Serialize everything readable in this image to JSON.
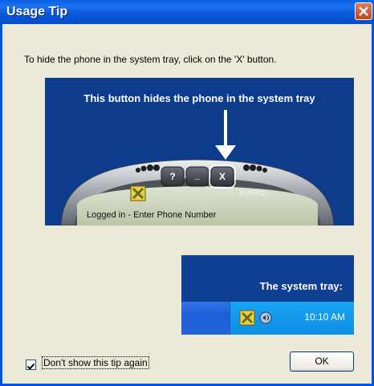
{
  "window": {
    "title": "Usage Tip"
  },
  "instruction": "To hide the phone in the system tray, click on the 'X' button.",
  "illustration": {
    "caption": "This button hides the phone in the system tray",
    "phone_buttons": [
      "?",
      "_",
      "X"
    ],
    "brand": "X-PRO",
    "status_text": "Logged in - Enter Phone Number"
  },
  "tray": {
    "caption": "The system tray:",
    "clock": "10:10 AM"
  },
  "footer": {
    "checkbox_label": "Don't show this tip again",
    "checkbox_checked": true,
    "ok_label": "OK"
  },
  "colors": {
    "title_bar": "#0A5FE0",
    "panel_bg": "#0D3C8C",
    "dialog_bg": "#ECE9D8"
  }
}
